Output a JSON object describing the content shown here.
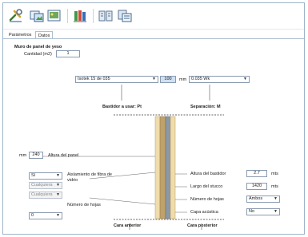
{
  "toolbar": {
    "buttons": [
      {
        "icon": "tools-icon"
      },
      {
        "icon": "image-export-icon"
      },
      {
        "icon": "image-view-icon"
      },
      {
        "icon": "panel-library-icon"
      },
      {
        "icon": "section-compare-icon"
      },
      {
        "icon": "section-copy-icon"
      }
    ]
  },
  "tabs": [
    {
      "label": "Parámetros",
      "active": false
    },
    {
      "label": "Datos",
      "active": true
    }
  ],
  "wall": {
    "section_title": "Muro de panel de yeso",
    "quantity_label": "Cantidad (m2)",
    "quantity_value": "1",
    "panel_select": "Isotek 15 de 035",
    "density_value": "100",
    "thickness_unit": "mm",
    "thickness_select": "0.035 Wk",
    "left_marker": "Bastidor a usar: Pt",
    "right_marker": "Separación: M",
    "height_label": "Altura del panel",
    "height_unit": "mm",
    "height_value": "240",
    "left_select_1": "Sí",
    "left_select_2": "Cualquiera",
    "left_select_3": "Cualquiera",
    "left_select_4": "0",
    "insulation_label": "Aislamiento de fibra de vidrio",
    "sheets_label_left": "Número de hojas",
    "stud_height_label": "Altura del bastidor",
    "stud_height_value": "2.7",
    "stud_height_unit": "mts",
    "stud_length_label": "Largo del stucco",
    "stud_length_value": "1420",
    "stud_length_unit": "mts",
    "sheets_label_right": "Número de hojas",
    "sheets_select": "Ambos",
    "last_label": "Capa acústica",
    "last_select": "No",
    "face_inside": "Cara anterior",
    "face_outside": "Cara posterior"
  },
  "colors": {
    "frame": "#9fb3c8",
    "panel_face": "#f0dcaa",
    "panel_core": "#bfa26a",
    "stud": "#7d8a96"
  }
}
